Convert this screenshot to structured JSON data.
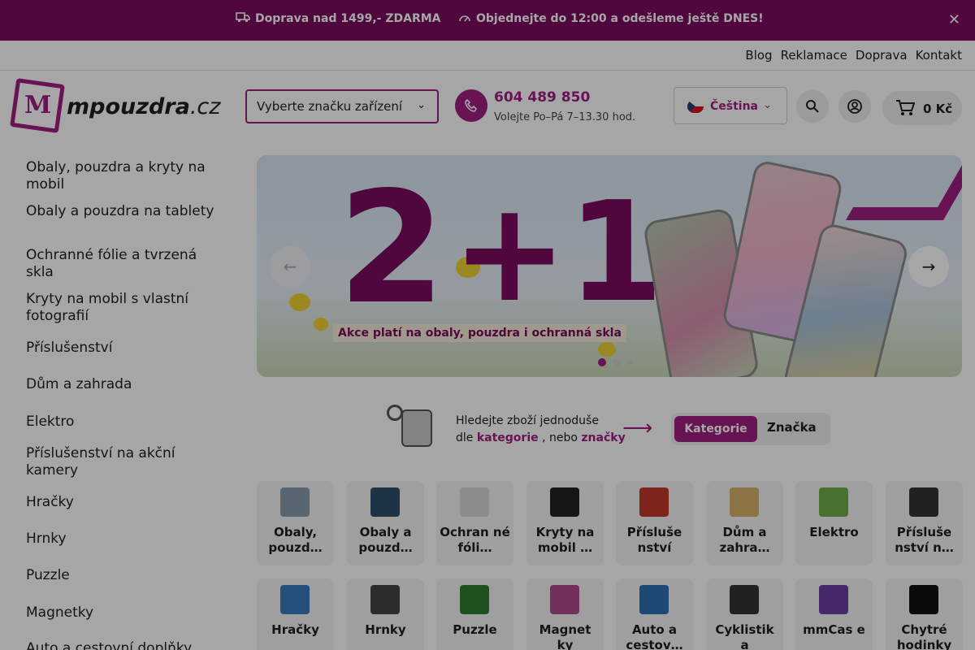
{
  "topbar": {
    "shipping": "Doprava nad 1499,- ZDARMA",
    "order_deadline": "Objednejte do 12:00 a odešleme ještě DNES!",
    "close_icon": "close-icon",
    "bg_color": "#7a0b5e"
  },
  "subnav": {
    "links": [
      "Blog",
      "Reklamace",
      "Doprava",
      "Kontakt"
    ]
  },
  "logo": {
    "mark": "M",
    "name": "mpouzdra",
    "tld": ".cz"
  },
  "header": {
    "brand_select": "Vyberte značku zařízení",
    "phone_number": "604 489 850",
    "phone_hours": "Volejte Po–Pá 7–13.30 hod.",
    "language": "Čeština",
    "cart_total": "0 Kč",
    "accent_color": "#a01e82"
  },
  "sidebar": {
    "categories": [
      "Obaly, pouzdra a kryty na mobil",
      "Obaly a pouzdra na tablety",
      "Ochranné fólie a tvrzená skla",
      "Kryty na mobil s vlastní fotografií",
      "Příslušenství",
      "Dům a zahrada",
      "Elektro",
      "Příslušenství na akční kamery",
      "Hračky",
      "Hrnky",
      "Puzzle",
      "Magnetky",
      "Auto a cestovní doplňky"
    ]
  },
  "banner": {
    "headline_two": "2",
    "headline_plus_one": "+1",
    "tagline": "Akce platí na obaly, pouzdra i ochranná skla",
    "slide_count": 3,
    "active_slide": 1
  },
  "finder": {
    "text_line1": "Hledejte zboží jednoduše",
    "text_prefix": "dle",
    "link_category": "kategorie",
    "text_mid": ", nebo",
    "link_brand": "značky",
    "toggle_active": "Kategorie",
    "toggle_inactive": "Značka"
  },
  "tiles": [
    {
      "label": "Obaly, pouzd…",
      "color": "#8a9bb0"
    },
    {
      "label": "Obaly a pouzd…",
      "color": "#2f4f6a"
    },
    {
      "label": "Ochran né fóli…",
      "color": "#d7d7d7"
    },
    {
      "label": "Kryty na mobil …",
      "color": "#222222"
    },
    {
      "label": "Přísluše nství",
      "color": "#c0392b"
    },
    {
      "label": "Dům a zahra…",
      "color": "#d9b36a"
    },
    {
      "label": "Elektro",
      "color": "#6fae4a"
    },
    {
      "label": "Přísluše nství n…",
      "color": "#333333"
    },
    {
      "label": "Hračky",
      "color": "#3b7bbf"
    },
    {
      "label": "Hrnky",
      "color": "#444444"
    },
    {
      "label": "Puzzle",
      "color": "#2e7d32"
    },
    {
      "label": "Magnet ky",
      "color": "#b04a8a"
    },
    {
      "label": "Auto a cestov…",
      "color": "#2f6fb5"
    },
    {
      "label": "Cyklistik a",
      "color": "#333333"
    },
    {
      "label": "mmCas e",
      "color": "#6a3fa0"
    },
    {
      "label": "Chytré hodinky",
      "color": "#111111"
    }
  ]
}
